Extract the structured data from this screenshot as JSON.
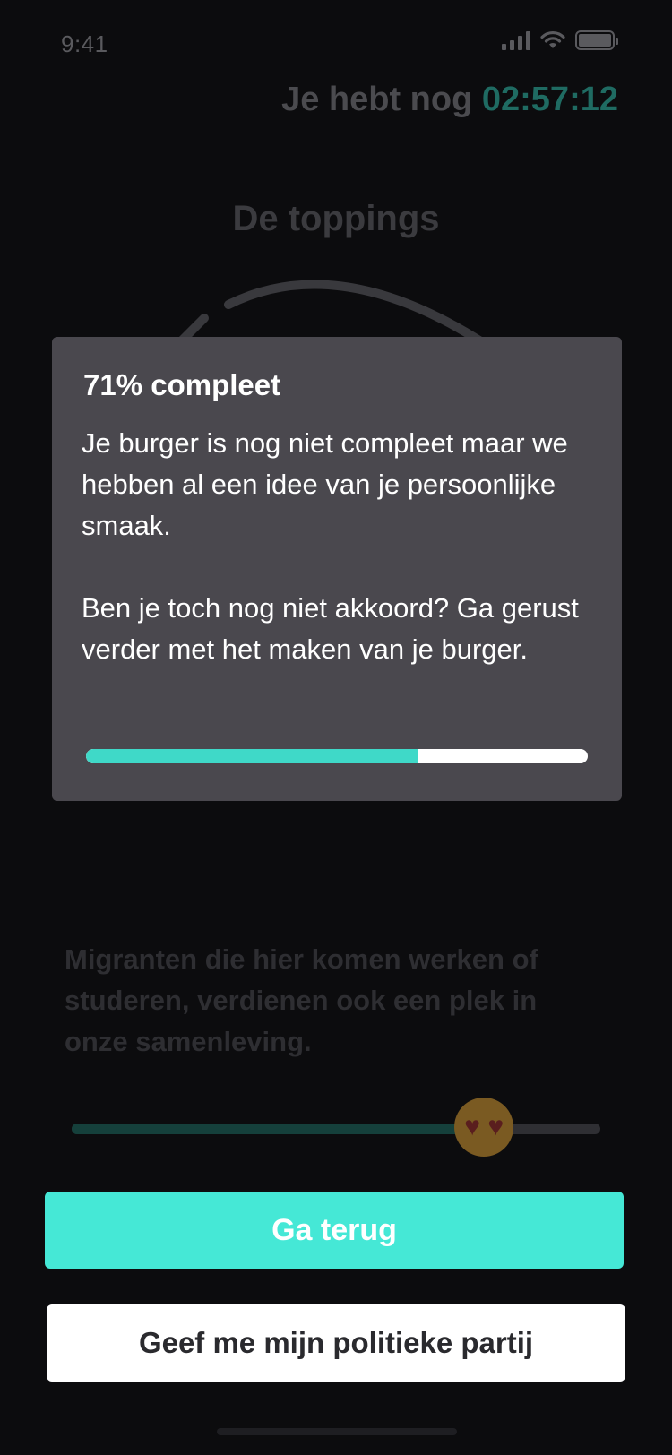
{
  "status_bar": {
    "time": "9:41"
  },
  "header": {
    "timer_prefix": "Je hebt nog",
    "timer_value": "02:57:12"
  },
  "section": {
    "title": "De toppings"
  },
  "question": {
    "statement": "Migranten die hier komen werken of studeren, verdienen ook een plek in onze samenleving.",
    "slider_value_fraction": 0.78,
    "slider_emoji": "smiling-face-with-heart-eyes"
  },
  "modal": {
    "title": "71% compleet",
    "body": "Je burger is nog niet compleet maar we hebben al een idee van je persoonlijke smaak.\n\nBen je toch nog niet akkoord? Ga gerust verder met het maken van je burger.",
    "progress_fraction": 0.66
  },
  "buttons": {
    "back_label": "Ga terug",
    "party_label": "Geef me mijn politieke partij"
  },
  "colors": {
    "accent": "#45e8d6",
    "progress_fill": "#3fd9c8",
    "modal_bg": "#4a484e",
    "background": "#0c0c0e"
  }
}
